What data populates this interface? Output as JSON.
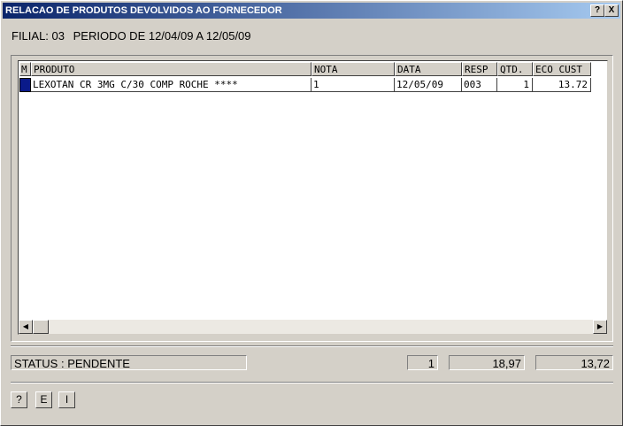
{
  "window": {
    "title": "RELACAO DE PRODUTOS DEVOLVIDOS AO FORNECEDOR",
    "help_button": "?",
    "close_button": "X"
  },
  "header": {
    "filial": "FILIAL: 03",
    "periodo": "PERIODO DE 12/04/09 A 12/05/09"
  },
  "table": {
    "columns": [
      "M",
      "PRODUTO",
      "NOTA",
      "DATA",
      "RESP",
      "QTD.",
      "ECO CUST"
    ],
    "rows": [
      {
        "produto": "LEXOTAN CR 3MG C/30 COMP ROCHE ****",
        "nota": "1",
        "data": "12/05/09",
        "resp": "003",
        "qtd": "1",
        "custo": "13.72"
      }
    ]
  },
  "scrollbar": {
    "left_arrow": "◀",
    "right_arrow": "▶"
  },
  "footer": {
    "status": "STATUS : PENDENTE",
    "total_qtd": "1",
    "total_1": "18,97",
    "total_2": "13,72"
  },
  "buttons": {
    "help": "?",
    "e": "E",
    "i": "I"
  }
}
